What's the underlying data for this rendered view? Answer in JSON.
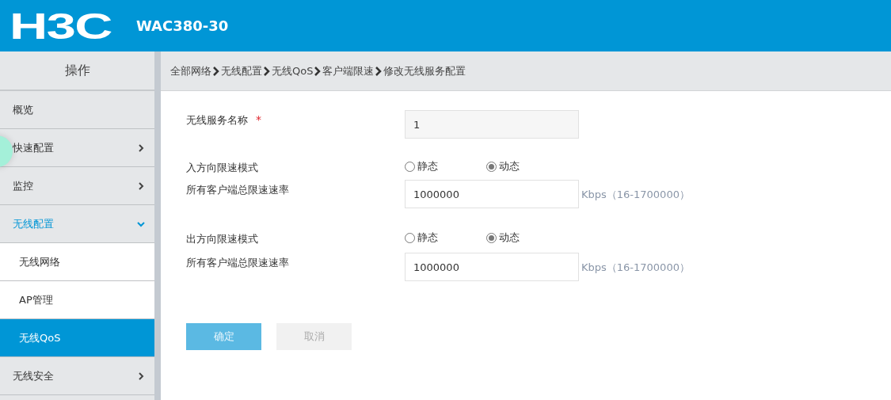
{
  "header": {
    "logo": "H3C",
    "device": "WAC380-30"
  },
  "sidebar": {
    "title": "操作",
    "items": [
      {
        "label": "概览",
        "kind": "leaf",
        "selected": false
      },
      {
        "label": "快速配置",
        "kind": "group",
        "expanded": false,
        "selected": false
      },
      {
        "label": "监控",
        "kind": "group",
        "expanded": false,
        "selected": false
      },
      {
        "label": "无线配置",
        "kind": "group",
        "expanded": true,
        "selected": false,
        "children": [
          {
            "label": "无线网络",
            "selected": false
          },
          {
            "label": "AP管理",
            "selected": false
          },
          {
            "label": "无线QoS",
            "selected": true
          }
        ]
      },
      {
        "label": "无线安全",
        "kind": "group",
        "expanded": false,
        "selected": false
      }
    ]
  },
  "breadcrumb": [
    "全部网络",
    "无线配置",
    "无线QoS",
    "客户端限速",
    "修改无线服务配置"
  ],
  "form": [
    {
      "kind": "text",
      "label": "无线服务名称",
      "required_mark": "*",
      "value": "1"
    },
    {
      "kind": "radio",
      "label": "入方向限速模式",
      "options": [
        {
          "label": "静态",
          "selected": false
        },
        {
          "label": "动态",
          "selected": true
        }
      ]
    },
    {
      "kind": "number",
      "label": "所有客户端总限速速率",
      "value": "1000000",
      "unit": "Kbps（16-1700000）"
    },
    {
      "kind": "radio",
      "label": "出方向限速模式",
      "options": [
        {
          "label": "静态",
          "selected": false
        },
        {
          "label": "动态",
          "selected": true
        }
      ]
    },
    {
      "kind": "number",
      "label": "所有客户端总限速速率",
      "value": "1000000",
      "unit": "Kbps（16-1700000）"
    }
  ],
  "buttons": [
    {
      "label": "确定",
      "kind": "primary"
    },
    {
      "label": "取消",
      "kind": "secondary"
    }
  ]
}
